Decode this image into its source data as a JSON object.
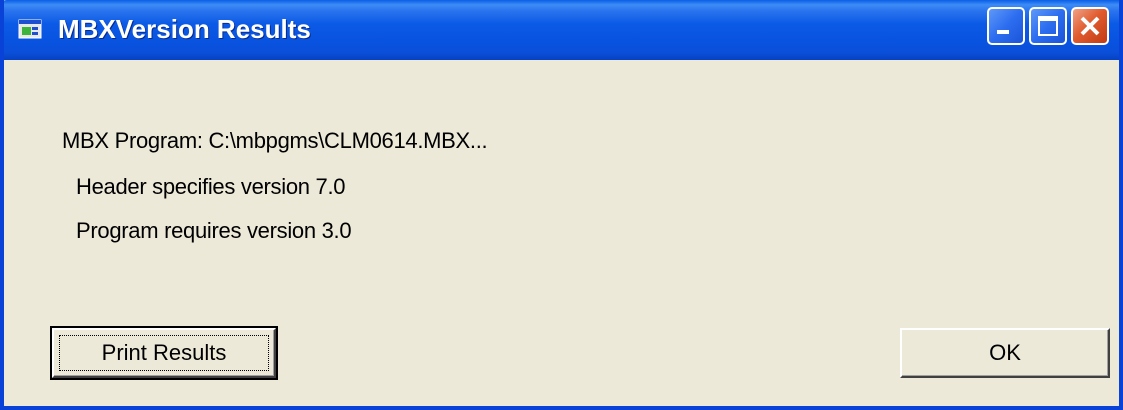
{
  "window": {
    "title": "MBXVersion Results",
    "title_icon": "app-window-icon",
    "controls": {
      "minimize_icon": "minimize-icon",
      "maximize_icon": "maximize-icon",
      "close_icon": "close-icon"
    },
    "accent_color": "#0842d6",
    "close_color": "#e05c2f"
  },
  "content": {
    "program_line": "MBX Program: C:\\mbpgms\\CLM0614.MBX...",
    "header_line": "Header specifies version 7.0",
    "requires_line": "Program requires version 3.0"
  },
  "buttons": {
    "print_label": "Print Results",
    "ok_label": "OK"
  }
}
